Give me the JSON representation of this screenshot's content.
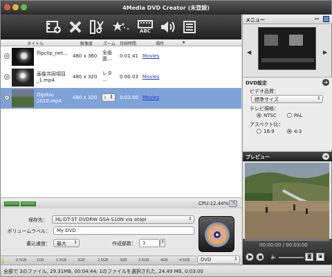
{
  "window": {
    "title": "4Media DVD Creator (未登録)"
  },
  "toolbar": {
    "buttons": [
      "add-file-icon",
      "delete-icon",
      "clip-icon",
      "effect-icon",
      "subtitle-icon",
      "audio-icon",
      "chapters-icon"
    ],
    "subtitle_icon_text": "ABC"
  },
  "columns": {
    "title": "タイトル",
    "resolution": "解像度",
    "zoom": "ズーム",
    "duration": "持続時間",
    "location": "場所",
    "star": "★"
  },
  "files": [
    {
      "name": "flipclip_net...",
      "resolution": "480 x 360",
      "zoom": "全画面...",
      "duration": "0:01:41",
      "location": "Movies",
      "selected": false
    },
    {
      "name": "画像共同項目_1.mp4",
      "resolution": "480 x 320",
      "zoom": "レタ...",
      "duration": "0:00:03",
      "location": "Movies",
      "selected": false
    },
    {
      "name": "Ogatsu 2010.mp4",
      "resolution": "480 x 320",
      "zoom": "i",
      "duration": "0:03:00",
      "location": "Movies",
      "selected": true
    }
  ],
  "file_list_rows": [
    {
      "name_l1": "flipclip_net...",
      "name_l2": "",
      "zoom_l1": "全画",
      "zoom_l2": "面..."
    },
    {
      "name_l1": "画像共同項目",
      "name_l2": "_1.mp4",
      "zoom_l1": "レタ",
      "zoom_l2": "..."
    },
    {
      "name_l1": "Ogatsu",
      "name_l2": "2010.mp4",
      "zoom_l1": "i",
      "zoom_l2": ""
    }
  ],
  "cpu": "CPU:12.44%",
  "settings": {
    "save_to_label": "保存先：",
    "save_to_value": "HL-DT-ST DVDRW GSA-S10N via atapi",
    "volume_label": "ボリュームラベル：",
    "volume_value": "My DVD",
    "write_speed_label": "書込速度：",
    "write_speed_value": "最大",
    "copies_label": "作成部数：",
    "copies_value": "1"
  },
  "capacity": {
    "ticks": [
      "0.5GB",
      "1GB",
      "1.5GB",
      "2GB",
      "2.5GB",
      "3GB",
      "3.5GB",
      "4GB",
      "4.5GB"
    ],
    "used_fraction": 0.007,
    "disc_type": "DVD"
  },
  "status": "全部で 3のファイル, 29.31MB, 00:04:44; 1のファイルを選択された, 24.49 MB, 0:03:00",
  "right_panel": {
    "menu_title": "メニュー",
    "dvd_settings_title": "DVD設定",
    "video_quality_label": "ビデオ品質：",
    "video_quality_value": "標準サイズ",
    "tv_standard_label": "テレビ規格：",
    "ntsc": "NTSC",
    "pal": "PAL",
    "aspect_label": "アスペクト比：",
    "aspect_169": "16:9",
    "aspect_43": "4:3",
    "preview_title": "プレビュー",
    "timecode": "00:00:00 / 00:03:00"
  },
  "colors": {
    "selection": "#7fa3d9",
    "link": "#2038c8",
    "accent_green": "#3a8a2a"
  }
}
